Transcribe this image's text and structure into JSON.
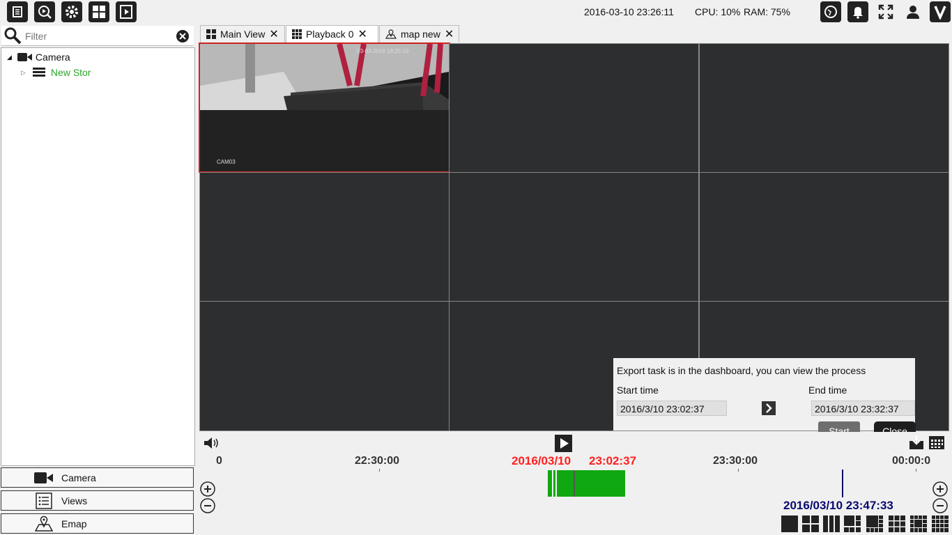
{
  "toolbar": {
    "icons": [
      "list-icon",
      "search-playback-icon",
      "gear-icon",
      "grid-icon",
      "film-icon"
    ],
    "right_icons": [
      "globe-icon",
      "bell-icon",
      "fullscreen-icon",
      "user-icon",
      "v-logo-icon"
    ]
  },
  "status": {
    "datetime": "2016-03-10 23:26:11",
    "cpu": "CPU: 10%",
    "ram": "RAM: 75%"
  },
  "filter": {
    "placeholder": "Filter"
  },
  "tree": {
    "root_label": "Camera",
    "child_label": "New Stor"
  },
  "nav": {
    "camera": "Camera",
    "views": "Views",
    "emap": "Emap"
  },
  "tabs": [
    {
      "label": "Main View"
    },
    {
      "label": "Playback 0"
    },
    {
      "label": "map new"
    }
  ],
  "video": {
    "overlay_timestamp": "03-03-2016 18:25:19",
    "camera_label": "CAM03"
  },
  "dialog": {
    "message": "Export task is in the dashboard, you can view the process",
    "start_label": "Start time",
    "end_label": "End time",
    "start_value": "2016/3/10 23:02:37",
    "end_value": "2016/3/10 23:32:37",
    "start_button": "Start",
    "close_button": "Close"
  },
  "timeline": {
    "ticks": [
      "0",
      "22:30:00",
      "23:30:00",
      "00:00:0"
    ],
    "selection_date": "2016/03/10",
    "selection_time": "23:02:37",
    "cursor_time": "2016/03/10 23:47:33"
  },
  "colors": {
    "selection_red": "#ff2020",
    "cursor_blue": "#0a0a6e",
    "recording_green": "#10a810"
  }
}
